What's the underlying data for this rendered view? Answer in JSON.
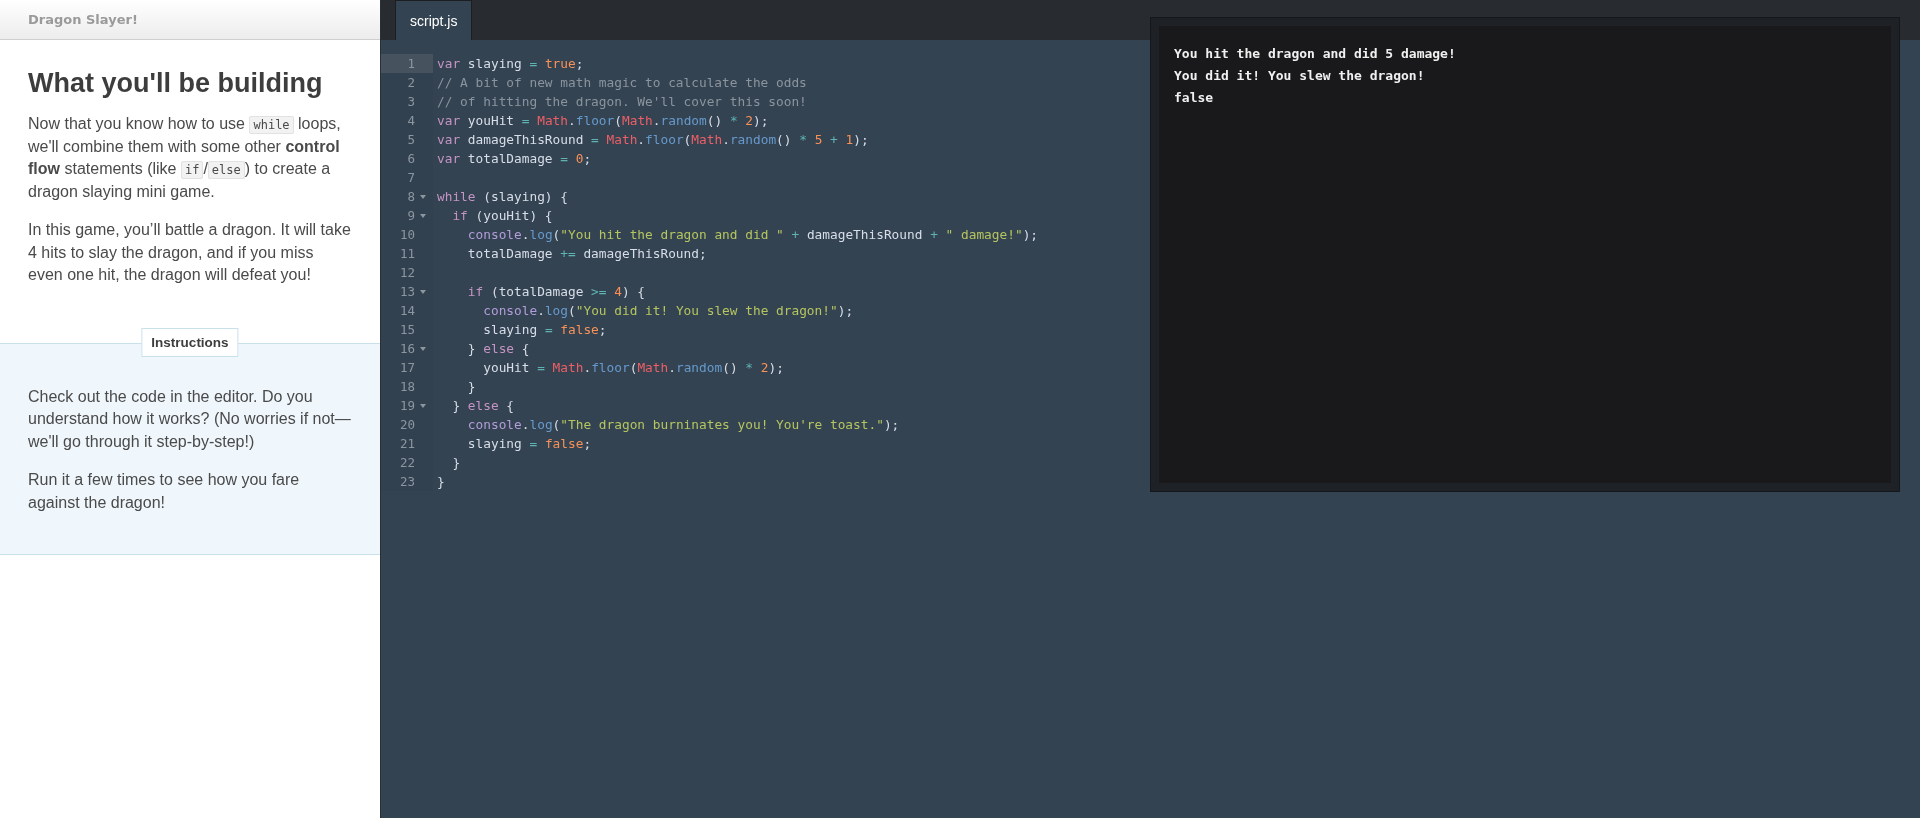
{
  "lesson": {
    "header": "Dragon Slayer!",
    "title": "What you'll be building",
    "paragraphs": [
      [
        {
          "kind": "text",
          "text": "Now that you know how to use "
        },
        {
          "kind": "code",
          "text": "while"
        },
        {
          "kind": "text",
          "text": " loops, we'll combine them with some other **control flow** statements (like "
        },
        {
          "kind": "code",
          "text": "if"
        },
        {
          "kind": "text",
          "text": "/"
        },
        {
          "kind": "code",
          "text": "else"
        },
        {
          "kind": "text",
          "text": ") to create a dragon slaying mini game."
        }
      ],
      [
        {
          "kind": "text",
          "text": "In this game, you’ll battle a dragon. It will take 4 hits to slay the dragon, and if you miss even one hit, the dragon will defeat you!"
        }
      ]
    ]
  },
  "instructions": {
    "label": "Instructions",
    "paragraphs": [
      "Check out the code in the editor. Do you understand how it works? (No worries if not—we'll go through it step-by-step!)",
      "Run it a few times to see how you fare against the dragon!"
    ]
  },
  "editor": {
    "tabs": [
      {
        "label": "script.js",
        "selected": true
      }
    ],
    "lines": [
      {
        "number": "1",
        "selected": true,
        "foldable": false,
        "tokens": [
          {
            "kind": "kw",
            "text": "var"
          },
          {
            "kind": "id",
            "text": " slaying "
          },
          {
            "kind": "op",
            "text": "="
          },
          {
            "kind": "num",
            "text": " true"
          },
          {
            "kind": "id",
            "text": ";"
          }
        ]
      },
      {
        "number": "2",
        "selected": false,
        "foldable": false,
        "tokens": [
          {
            "kind": "comment",
            "text": "// A bit of new math magic to calculate the odds"
          }
        ]
      },
      {
        "number": "3",
        "selected": false,
        "foldable": false,
        "tokens": [
          {
            "kind": "comment",
            "text": "// of hitting the dragon. We'll cover this soon!"
          }
        ]
      },
      {
        "number": "4",
        "selected": false,
        "foldable": false,
        "tokens": [
          {
            "kind": "kw",
            "text": "var"
          },
          {
            "kind": "id",
            "text": " youHit "
          },
          {
            "kind": "op",
            "text": "="
          },
          {
            "kind": "builtin",
            "text": " Math"
          },
          {
            "kind": "id",
            "text": "."
          },
          {
            "kind": "fn",
            "text": "floor"
          },
          {
            "kind": "id",
            "text": "("
          },
          {
            "kind": "builtin",
            "text": "Math"
          },
          {
            "kind": "id",
            "text": "."
          },
          {
            "kind": "fn",
            "text": "random"
          },
          {
            "kind": "id",
            "text": "() "
          },
          {
            "kind": "op",
            "text": "*"
          },
          {
            "kind": "num",
            "text": " 2"
          },
          {
            "kind": "id",
            "text": ");"
          }
        ]
      },
      {
        "number": "5",
        "selected": false,
        "foldable": false,
        "tokens": [
          {
            "kind": "kw",
            "text": "var"
          },
          {
            "kind": "id",
            "text": " damageThisRound "
          },
          {
            "kind": "op",
            "text": "="
          },
          {
            "kind": "builtin",
            "text": " Math"
          },
          {
            "kind": "id",
            "text": "."
          },
          {
            "kind": "fn",
            "text": "floor"
          },
          {
            "kind": "id",
            "text": "("
          },
          {
            "kind": "builtin",
            "text": "Math"
          },
          {
            "kind": "id",
            "text": "."
          },
          {
            "kind": "fn",
            "text": "random"
          },
          {
            "kind": "id",
            "text": "() "
          },
          {
            "kind": "op",
            "text": "*"
          },
          {
            "kind": "num",
            "text": " 5 "
          },
          {
            "kind": "op",
            "text": "+"
          },
          {
            "kind": "num",
            "text": " 1"
          },
          {
            "kind": "id",
            "text": ");"
          }
        ]
      },
      {
        "number": "6",
        "selected": false,
        "foldable": false,
        "tokens": [
          {
            "kind": "kw",
            "text": "var"
          },
          {
            "kind": "id",
            "text": " totalDamage "
          },
          {
            "kind": "op",
            "text": "="
          },
          {
            "kind": "num",
            "text": " 0"
          },
          {
            "kind": "id",
            "text": ";"
          }
        ]
      },
      {
        "number": "7",
        "selected": false,
        "foldable": false
      },
      {
        "number": "8",
        "selected": false,
        "foldable": true,
        "tokens": [
          {
            "kind": "kw",
            "text": "while"
          },
          {
            "kind": "id",
            "text": " (slaying) {"
          }
        ]
      },
      {
        "number": "9",
        "selected": false,
        "foldable": true,
        "tokens": [
          {
            "kind": "kw",
            "text": "  if"
          },
          {
            "kind": "id",
            "text": " (youHit) {"
          }
        ]
      },
      {
        "number": "10",
        "selected": false,
        "foldable": false,
        "tokens": [
          {
            "kind": "fn2",
            "text": "    console"
          },
          {
            "kind": "id",
            "text": "."
          },
          {
            "kind": "fn",
            "text": "log"
          },
          {
            "kind": "id",
            "text": "("
          },
          {
            "kind": "str",
            "text": "\"You hit the dragon and did \""
          },
          {
            "kind": "op",
            "text": " +"
          },
          {
            "kind": "id",
            "text": " damageThisRound "
          },
          {
            "kind": "op",
            "text": "+"
          },
          {
            "kind": "str",
            "text": " \" damage!\""
          },
          {
            "kind": "id",
            "text": ");"
          }
        ]
      },
      {
        "number": "11",
        "selected": false,
        "foldable": false,
        "tokens": [
          {
            "kind": "id",
            "text": "    totalDamage "
          },
          {
            "kind": "op",
            "text": "+="
          },
          {
            "kind": "id",
            "text": " damageThisRound;"
          }
        ]
      },
      {
        "number": "12",
        "selected": false,
        "foldable": false
      },
      {
        "number": "13",
        "selected": false,
        "foldable": true,
        "tokens": [
          {
            "kind": "kw",
            "text": "    if"
          },
          {
            "kind": "id",
            "text": " (totalDamage "
          },
          {
            "kind": "op",
            "text": ">="
          },
          {
            "kind": "num",
            "text": " 4"
          },
          {
            "kind": "id",
            "text": ") {"
          }
        ]
      },
      {
        "number": "14",
        "selected": false,
        "foldable": false,
        "tokens": [
          {
            "kind": "fn2",
            "text": "      console"
          },
          {
            "kind": "id",
            "text": "."
          },
          {
            "kind": "fn",
            "text": "log"
          },
          {
            "kind": "id",
            "text": "("
          },
          {
            "kind": "str",
            "text": "\"You did it! You slew the dragon!\""
          },
          {
            "kind": "id",
            "text": ");"
          }
        ]
      },
      {
        "number": "15",
        "selected": false,
        "foldable": false,
        "tokens": [
          {
            "kind": "id",
            "text": "      slaying "
          },
          {
            "kind": "op",
            "text": "="
          },
          {
            "kind": "num",
            "text": " false"
          },
          {
            "kind": "id",
            "text": ";"
          }
        ]
      },
      {
        "number": "16",
        "selected": false,
        "foldable": true,
        "tokens": [
          {
            "kind": "id",
            "text": "    } "
          },
          {
            "kind": "kw",
            "text": "else"
          },
          {
            "kind": "id",
            "text": " {"
          }
        ]
      },
      {
        "number": "17",
        "selected": false,
        "foldable": false,
        "tokens": [
          {
            "kind": "id",
            "text": "      youHit "
          },
          {
            "kind": "op",
            "text": "="
          },
          {
            "kind": "builtin",
            "text": " Math"
          },
          {
            "kind": "id",
            "text": "."
          },
          {
            "kind": "fn",
            "text": "floor"
          },
          {
            "kind": "id",
            "text": "("
          },
          {
            "kind": "builtin",
            "text": "Math"
          },
          {
            "kind": "id",
            "text": "."
          },
          {
            "kind": "fn",
            "text": "random"
          },
          {
            "kind": "id",
            "text": "() "
          },
          {
            "kind": "op",
            "text": "*"
          },
          {
            "kind": "num",
            "text": " 2"
          },
          {
            "kind": "id",
            "text": ");"
          }
        ]
      },
      {
        "number": "18",
        "selected": false,
        "foldable": false,
        "tokens": [
          {
            "kind": "id",
            "text": "    }"
          }
        ]
      },
      {
        "number": "19",
        "selected": false,
        "foldable": true,
        "tokens": [
          {
            "kind": "id",
            "text": "  } "
          },
          {
            "kind": "kw",
            "text": "else"
          },
          {
            "kind": "id",
            "text": " {"
          }
        ]
      },
      {
        "number": "20",
        "selected": false,
        "foldable": false,
        "tokens": [
          {
            "kind": "fn2",
            "text": "    console"
          },
          {
            "kind": "id",
            "text": "."
          },
          {
            "kind": "fn",
            "text": "log"
          },
          {
            "kind": "id",
            "text": "("
          },
          {
            "kind": "str",
            "text": "\"The dragon burninates you! You're toast.\""
          },
          {
            "kind": "id",
            "text": ");"
          }
        ]
      },
      {
        "number": "21",
        "selected": false,
        "foldable": false,
        "tokens": [
          {
            "kind": "id",
            "text": "    slaying "
          },
          {
            "kind": "op",
            "text": "="
          },
          {
            "kind": "num",
            "text": " false"
          },
          {
            "kind": "id",
            "text": ";"
          }
        ]
      },
      {
        "number": "22",
        "selected": false,
        "foldable": false,
        "tokens": [
          {
            "kind": "id",
            "text": "  }"
          }
        ]
      },
      {
        "number": "23",
        "selected": false,
        "foldable": false,
        "tokens": [
          {
            "kind": "id",
            "text": "}"
          }
        ]
      }
    ]
  },
  "console": {
    "lines": [
      "You hit the dragon and did 5 damage!",
      "You did it! You slew the dragon!",
      "false"
    ]
  }
}
